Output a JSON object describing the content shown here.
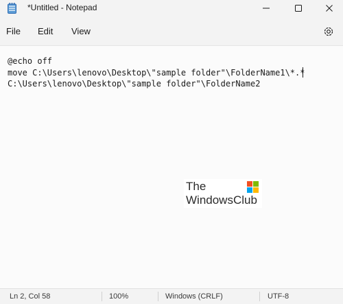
{
  "window": {
    "title": "*Untitled - Notepad"
  },
  "menu": {
    "file": "File",
    "edit": "Edit",
    "view": "View"
  },
  "editor": {
    "lines": [
      "@echo off",
      "move C:\\Users\\lenovo\\Desktop\\\"sample folder\"\\FolderName1\\*.*",
      "C:\\Users\\lenovo\\Desktop\\\"sample folder\"\\FolderName2"
    ]
  },
  "watermark": {
    "line1": "The",
    "line2": "WindowsClub"
  },
  "status": {
    "position": "Ln 2, Col 58",
    "zoom": "100%",
    "line_ending": "Windows (CRLF)",
    "encoding": "UTF-8"
  },
  "colors": {
    "background": "#f3f3f3",
    "editor_bg": "#fbfbfb",
    "text": "#1a1a1a"
  },
  "icons": [
    "notepad-icon",
    "minimize-icon",
    "maximize-icon",
    "close-icon",
    "settings-gear-icon",
    "windows-logo-icon"
  ]
}
